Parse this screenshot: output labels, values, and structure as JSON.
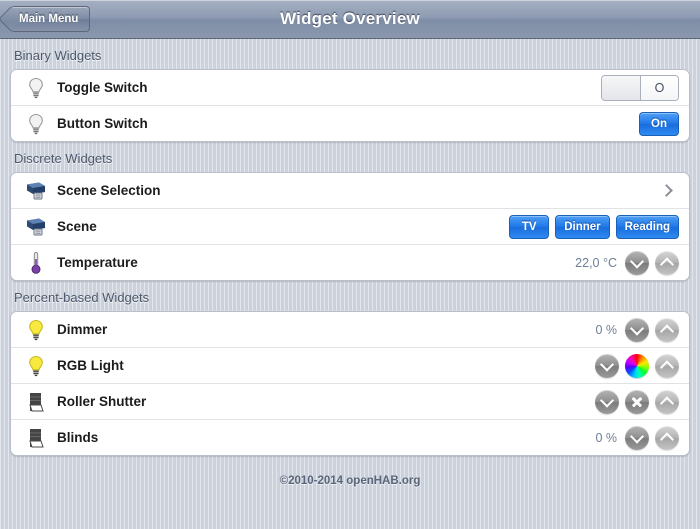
{
  "titlebar": {
    "back_label": "Main Menu",
    "title": "Widget Overview"
  },
  "sections": [
    {
      "header": "Binary Widgets",
      "rows": [
        {
          "icon": "lightbulb-off-icon",
          "label": "Toggle Switch",
          "control": "toggle",
          "toggle_state": "O"
        },
        {
          "icon": "lightbulb-off-icon",
          "label": "Button Switch",
          "control": "button",
          "button_label": "On"
        }
      ]
    },
    {
      "header": "Discrete Widgets",
      "rows": [
        {
          "icon": "scene-icon",
          "label": "Scene Selection",
          "control": "chevron"
        },
        {
          "icon": "scene-icon",
          "label": "Scene",
          "control": "button-group",
          "buttons": [
            "TV",
            "Dinner",
            "Reading"
          ]
        },
        {
          "icon": "temperature-icon",
          "label": "Temperature",
          "control": "stepper",
          "value": "22,0 °C"
        }
      ]
    },
    {
      "header": "Percent-based Widgets",
      "rows": [
        {
          "icon": "lightbulb-on-icon",
          "label": "Dimmer",
          "control": "stepper",
          "value": "0 %"
        },
        {
          "icon": "lightbulb-on-icon",
          "label": "RGB Light",
          "control": "stepper-color"
        },
        {
          "icon": "rollershutter-icon",
          "label": "Roller Shutter",
          "control": "stepper-stop"
        },
        {
          "icon": "rollershutter-icon",
          "label": "Blinds",
          "control": "stepper",
          "value": "0 %"
        }
      ]
    }
  ],
  "footer": {
    "copyright": "©2010-2014 openHAB.org"
  },
  "colors": {
    "accent_blue": "#2079e8",
    "titlebar": "#8e9bb2",
    "page_bg": "#ccd2dc",
    "value_text": "#6f7f95"
  }
}
